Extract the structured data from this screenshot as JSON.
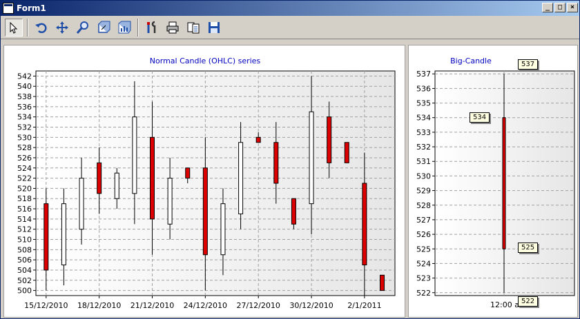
{
  "window": {
    "title": "Form1"
  },
  "toolbar": {
    "tools": [
      {
        "name": "pointer-icon"
      },
      {
        "name": "rotate-icon"
      },
      {
        "name": "move-icon"
      },
      {
        "name": "zoom-icon"
      },
      {
        "name": "edit-3d-icon"
      },
      {
        "name": "chart-gallery-icon"
      },
      {
        "name": "tools-icon"
      },
      {
        "name": "print-icon"
      },
      {
        "name": "copy-icon"
      },
      {
        "name": "save-icon"
      }
    ]
  },
  "chart1": {
    "title": "Normal Candle (OHLC) series",
    "ylim": [
      499,
      543
    ],
    "y_ticks": [
      500,
      502,
      504,
      506,
      508,
      510,
      512,
      514,
      516,
      518,
      520,
      522,
      524,
      526,
      528,
      530,
      532,
      534,
      536,
      538,
      540,
      542
    ],
    "x_labels": [
      "15/12/2010",
      "18/12/2010",
      "21/12/2010",
      "24/12/2010",
      "27/12/2010",
      "30/12/2010",
      "2/1/2011"
    ]
  },
  "chart2": {
    "title": "Big-Candle",
    "ylim": [
      521.8,
      537.2
    ],
    "y_ticks": [
      522,
      523,
      524,
      525,
      526,
      527,
      528,
      529,
      530,
      531,
      532,
      533,
      534,
      535,
      536,
      537
    ],
    "x_label": "12:00 a.m.",
    "callouts": {
      "high": "537",
      "open": "534",
      "close": "525",
      "low": "522"
    }
  },
  "chart_data": [
    {
      "type": "candlestick",
      "title": "Normal Candle (OHLC) series",
      "candles": [
        {
          "open": 517,
          "high": 520,
          "low": 500,
          "close": 504
        },
        {
          "open": 505,
          "high": 520,
          "low": 501,
          "close": 517
        },
        {
          "open": 512,
          "high": 526,
          "low": 509,
          "close": 522
        },
        {
          "open": 525,
          "high": 528,
          "low": 515,
          "close": 519
        },
        {
          "open": 518,
          "high": 524,
          "low": 516,
          "close": 523
        },
        {
          "open": 519,
          "high": 541,
          "low": 513,
          "close": 534
        },
        {
          "open": 530,
          "high": 537,
          "low": 507,
          "close": 514
        },
        {
          "open": 513,
          "high": 526,
          "low": 510,
          "close": 522
        },
        {
          "open": 524,
          "high": 524,
          "low": 521,
          "close": 522
        },
        {
          "open": 524,
          "high": 530,
          "low": 500,
          "close": 507
        },
        {
          "open": 507,
          "high": 520,
          "low": 503,
          "close": 517
        },
        {
          "open": 515,
          "high": 533,
          "low": 512,
          "close": 529
        },
        {
          "open": 530,
          "high": 531,
          "low": 529,
          "close": 529
        },
        {
          "open": 529,
          "high": 533,
          "low": 517,
          "close": 521
        },
        {
          "open": 518,
          "high": 518,
          "low": 512,
          "close": 513
        },
        {
          "open": 517,
          "high": 542,
          "low": 511,
          "close": 535
        },
        {
          "open": 534,
          "high": 537,
          "low": 522,
          "close": 525
        },
        {
          "open": 529,
          "high": 529,
          "low": 525,
          "close": 525
        },
        {
          "open": 521,
          "high": 527,
          "low": 499,
          "close": 505
        },
        {
          "open": 503,
          "high": 503,
          "low": 500,
          "close": 500
        }
      ]
    },
    {
      "type": "candlestick",
      "title": "Big-Candle",
      "candles": [
        {
          "open": 534,
          "high": 537,
          "low": 522,
          "close": 525
        }
      ]
    }
  ]
}
